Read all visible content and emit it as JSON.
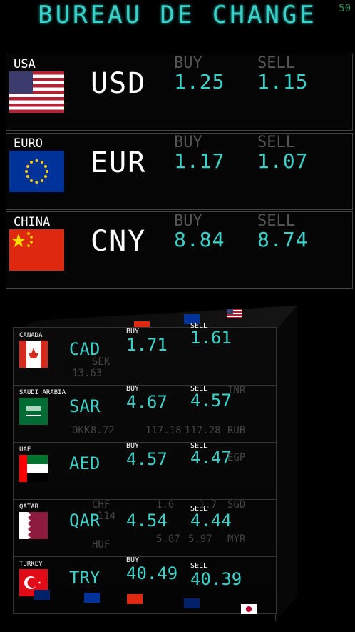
{
  "header": {
    "title": "BUREAU DE CHANGE",
    "corner": "50"
  },
  "colors": {
    "accent": "#39d1c8",
    "dim": "#555555"
  },
  "labels": {
    "buy": "BUY",
    "sell": "SELL"
  },
  "panels": [
    {
      "country": "USA",
      "code": "USD",
      "buy": "1.25",
      "sell": "1.15",
      "flag": "usa-flag"
    },
    {
      "country": "EURO",
      "code": "EUR",
      "buy": "1.17",
      "sell": "1.07",
      "flag": "eu-flag"
    },
    {
      "country": "CHINA",
      "code": "CNY",
      "buy": "8.84",
      "sell": "8.74",
      "flag": "china-flag"
    }
  ],
  "cube": {
    "rows": [
      {
        "country": "CANADA",
        "code": "CAD",
        "buy": "1.71",
        "sell": "1.61",
        "flag": "canada-flag"
      },
      {
        "country": "SAUDI ARABIA",
        "code": "SAR",
        "buy": "4.67",
        "sell": "4.57",
        "flag": "saudi-flag"
      },
      {
        "country": "UAE",
        "code": "AED",
        "buy": "4.57",
        "sell": "4.47",
        "flag": "uae-flag"
      },
      {
        "country": "QATAR",
        "code": "QAR",
        "buy": "4.54",
        "sell": "4.44",
        "flag": "qatar-flag"
      },
      {
        "country": "TURKEY",
        "code": "TRY",
        "buy": "40.49",
        "sell": "40.39",
        "flag": "turkey-flag"
      }
    ],
    "ghost": {
      "inr": "INR",
      "rub": "RUB",
      "egp": "EGP",
      "sgd": "SGD",
      "myr": "MYR",
      "dkk": "DKK",
      "sek": "SEK",
      "chf": "CHF",
      "huf": "HUF",
      "v1": "117.28",
      "v2": "117.18",
      "v3": "13.63",
      "v4": "8.72",
      "v5": "1.7",
      "v6": "1.6",
      "v7": "5.97",
      "v8": "5.87",
      "v9": "114"
    }
  }
}
